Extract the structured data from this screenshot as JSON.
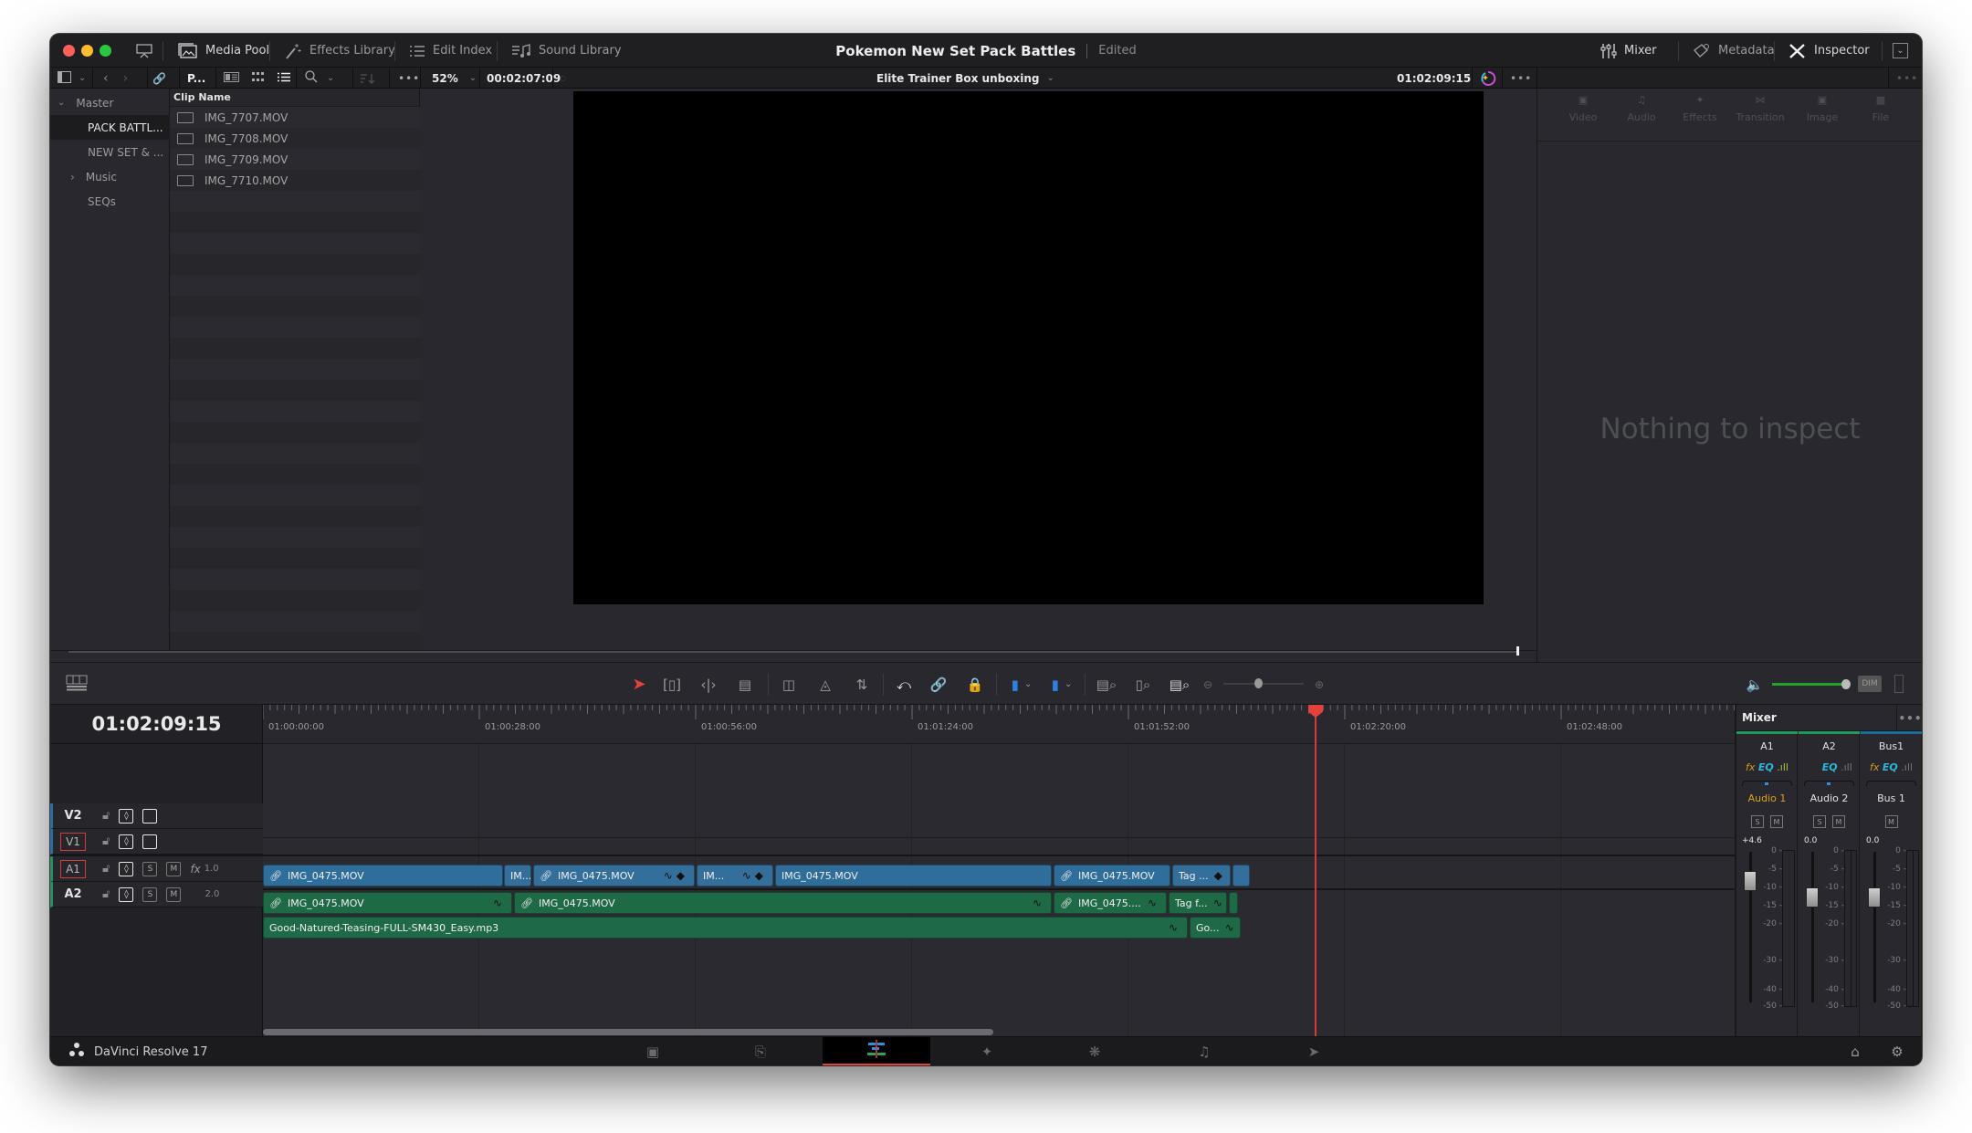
{
  "titlebar": {
    "project_title": "Pokemon New Set Pack Battles",
    "status": "Edited",
    "left_tabs": [
      {
        "label": "Media Pool",
        "icon": "image-icon"
      },
      {
        "label": "Effects Library",
        "icon": "magic-wand-icon"
      },
      {
        "label": "Edit Index",
        "icon": "list-icon"
      },
      {
        "label": "Sound Library",
        "icon": "music-list-icon"
      }
    ],
    "right_tabs": [
      {
        "label": "Mixer",
        "icon": "sliders-icon"
      },
      {
        "label": "Metadata",
        "icon": "tag-icon"
      },
      {
        "label": "Inspector",
        "icon": "tools-icon"
      }
    ]
  },
  "toolbar2": {
    "bin_path": "P...",
    "zoom": "52%",
    "source_duration": "00:02:07:09",
    "timeline_name": "Elite Trainer Box unboxing",
    "record_timecode": "01:02:09:15"
  },
  "media_pool": {
    "bins": [
      {
        "label": "Master",
        "expander": "v"
      },
      {
        "label": "PACK BATTL...",
        "selected": true
      },
      {
        "label": "NEW SET & ..."
      },
      {
        "label": "Music",
        "expander": ">"
      },
      {
        "label": "SEQs"
      }
    ],
    "column_header": "Clip Name",
    "clips": [
      "IMG_7707.MOV",
      "IMG_7708.MOV",
      "IMG_7709.MOV",
      "IMG_7710.MOV"
    ]
  },
  "inspector": {
    "tabs": [
      "Video",
      "Audio",
      "Effects",
      "Transition",
      "Image",
      "File"
    ],
    "empty_message": "Nothing to inspect"
  },
  "timeline": {
    "current_timecode": "01:02:09:15",
    "ruler_labels": [
      "01:00:00:00",
      "01:00:28:00",
      "01:00:56:00",
      "01:01:24:00",
      "01:01:52:00",
      "01:02:20:00",
      "01:02:48:00"
    ],
    "tracks": [
      {
        "name": "V2",
        "type": "video"
      },
      {
        "name": "V1",
        "type": "video",
        "target": true
      },
      {
        "name": "A1",
        "type": "audio",
        "target": true,
        "level": "1.0",
        "fx": "fx"
      },
      {
        "name": "A2",
        "type": "audio",
        "level": "2.0"
      }
    ],
    "v1_clips": [
      "IMG_0475.MOV",
      "IM...",
      "IMG_0475.MOV",
      "IM...",
      "IMG_0475.MOV",
      "IMG_0475.MOV",
      "Tag ..."
    ],
    "a1_clips": [
      "IMG_0475.MOV",
      "IMG_0475.MOV",
      "IMG_0475....",
      "Tag f..."
    ],
    "a2_clips": [
      "Good-Natured-Teasing-FULL-SM430_Easy.mp3",
      "Go..."
    ],
    "volume_dim_label": "DIM",
    "solo_label": "S",
    "mute_label": "M"
  },
  "mixer": {
    "title": "Mixer",
    "channels": [
      {
        "id": "A1",
        "name": "Audio 1",
        "level": "+4.6",
        "has_fx": true,
        "has_solo": true,
        "color": "#1f9a5c",
        "name_color": "#e0a21b"
      },
      {
        "id": "A2",
        "name": "Audio 2",
        "level": "0.0",
        "has_fx": false,
        "has_solo": true,
        "color": "#1f9a5c",
        "name_color": "#e3e3e3"
      },
      {
        "id": "Bus1",
        "name": "Bus 1",
        "level": "0.0",
        "has_fx": true,
        "has_solo": false,
        "color": "#1a6f9a",
        "name_color": "#e3e3e3"
      }
    ],
    "scale": [
      "0",
      "-5",
      "-10",
      "-15",
      "-20",
      "-30",
      "-40",
      "-50"
    ],
    "fx_label": "fx",
    "eq_label": "EQ"
  },
  "pagebar": {
    "app_name": "DaVinci Resolve 17",
    "pages": [
      "Media",
      "Cut",
      "Edit",
      "Fusion",
      "Color",
      "Fairlight",
      "Deliver"
    ],
    "active_page": "Edit"
  },
  "colors": {
    "accent_red": "#e5403a",
    "video_clip": "#2f6d9b",
    "audio_clip": "#1f6a46"
  }
}
